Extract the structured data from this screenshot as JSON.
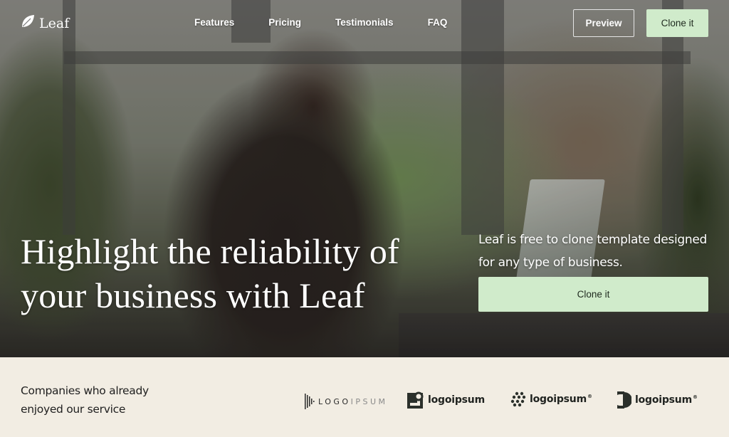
{
  "brand": {
    "name": "Leaf",
    "icon": "leaf-icon"
  },
  "nav": {
    "links": [
      {
        "label": "Features"
      },
      {
        "label": "Pricing"
      },
      {
        "label": "Testimonials"
      },
      {
        "label": "FAQ"
      }
    ],
    "preview_label": "Preview",
    "clone_label": "Clone it"
  },
  "hero": {
    "headline": "Highlight the reliability of your business with Leaf",
    "tagline": "Leaf is free to clone template designed for any type of business.",
    "cta_label": "Clone it",
    "image_description": "woman-working-on-laptop-by-window"
  },
  "companies": {
    "text": "Companies who already enjoyed our service",
    "logos": [
      {
        "name": "LOGOIPSUM",
        "name_dark": "LOGO",
        "name_light": "IPSUM"
      },
      {
        "name": "logoipsum"
      },
      {
        "name": "logoipsum",
        "mark": "®"
      },
      {
        "name": "logoipsum",
        "mark": "®"
      }
    ]
  },
  "colors": {
    "accent": "#d0ebcb",
    "footer_bg": "#f2ede3",
    "text_dark": "#1f1f1f"
  }
}
